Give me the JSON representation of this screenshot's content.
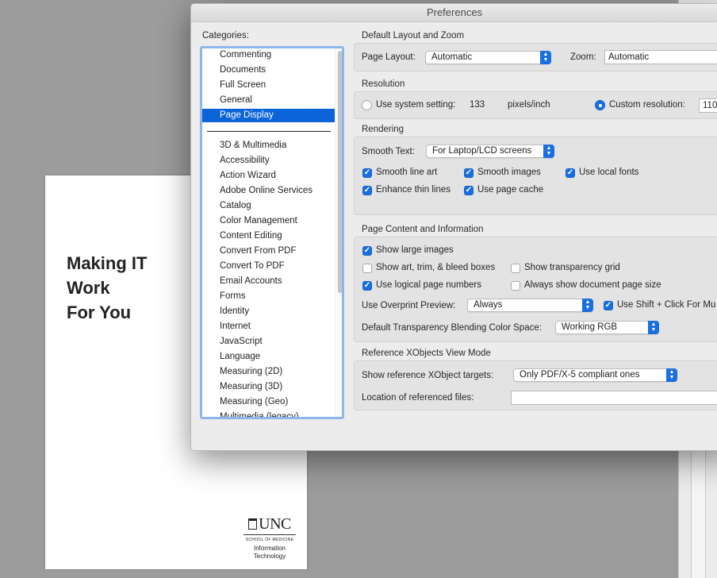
{
  "document": {
    "title_lines": [
      "Making IT",
      "Work",
      "For You"
    ],
    "logo": {
      "mark": "UNC",
      "school": "SCHOOL OF MEDICINE",
      "dept_line1": "Information",
      "dept_line2": "Technology"
    }
  },
  "dialog": {
    "title": "Preferences",
    "categories_label": "Categories:",
    "categories_top": [
      "Commenting",
      "Documents",
      "Full Screen",
      "General",
      "Page Display"
    ],
    "selected_category": "Page Display",
    "categories_bottom": [
      "3D & Multimedia",
      "Accessibility",
      "Action Wizard",
      "Adobe Online Services",
      "Catalog",
      "Color Management",
      "Content Editing",
      "Convert From PDF",
      "Convert To PDF",
      "Email Accounts",
      "Forms",
      "Identity",
      "Internet",
      "JavaScript",
      "Language",
      "Measuring (2D)",
      "Measuring (3D)",
      "Measuring (Geo)",
      "Multimedia (legacy)"
    ],
    "layout_zoom": {
      "title": "Default Layout and Zoom",
      "page_layout_label": "Page Layout:",
      "page_layout_value": "Automatic",
      "zoom_label": "Zoom:",
      "zoom_value": "Automatic"
    },
    "resolution": {
      "title": "Resolution",
      "system_label": "Use system setting:",
      "system_value": "133",
      "system_unit": "pixels/inch",
      "custom_label": "Custom resolution:",
      "custom_value": "110",
      "custom_selected": true
    },
    "rendering": {
      "title": "Rendering",
      "smooth_text_label": "Smooth Text:",
      "smooth_text_value": "For Laptop/LCD screens",
      "smooth_line_art": "Smooth line art",
      "smooth_images": "Smooth images",
      "use_local_fonts": "Use local fonts",
      "enhance_thin_lines": "Enhance thin lines",
      "use_page_cache": "Use page cache"
    },
    "page_content": {
      "title": "Page Content and Information",
      "show_large_images": "Show large images",
      "show_art_trim": "Show art, trim, & bleed boxes",
      "show_transparency_grid": "Show transparency grid",
      "use_logical_page_numbers": "Use logical page numbers",
      "always_show_page_size": "Always show document page size",
      "overprint_label": "Use Overprint Preview:",
      "overprint_value": "Always",
      "shift_click": "Use Shift + Click For Mu",
      "blend_label": "Default Transparency Blending Color Space:",
      "blend_value": "Working RGB"
    },
    "xobjects": {
      "title": "Reference XObjects View Mode",
      "targets_label": "Show reference XObject targets:",
      "targets_value": "Only PDF/X-5 compliant ones",
      "location_label": "Location of referenced files:",
      "location_value": ""
    }
  }
}
